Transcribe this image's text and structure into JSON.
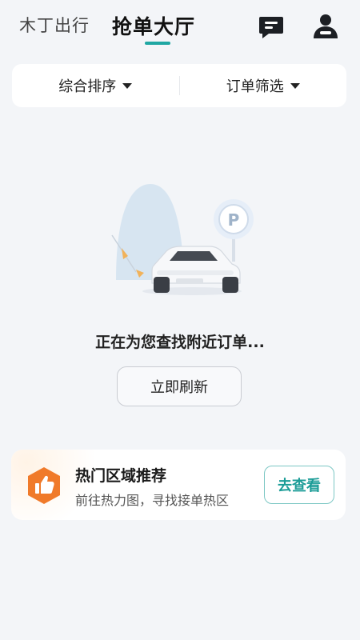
{
  "header": {
    "tab_secondary": "木丁出行",
    "tab_primary": "抢单大厅",
    "message_icon": "message-icon",
    "user_icon": "user-icon",
    "accent_color": "#1fa7a3"
  },
  "filters": {
    "sort_label": "综合排序",
    "order_filter_label": "订单筛选"
  },
  "empty_state": {
    "status_text": "正在为您查找附近订单...",
    "refresh_label": "立即刷新",
    "illustration": "car-parking-illustration",
    "parking_sign": "P"
  },
  "hot_area": {
    "title": "热门区域推荐",
    "subtitle": "前往热力图，寻找接单热区",
    "button_label": "去查看",
    "badge_icon": "thumbs-up-icon",
    "badge_color": "#f07a2a"
  }
}
